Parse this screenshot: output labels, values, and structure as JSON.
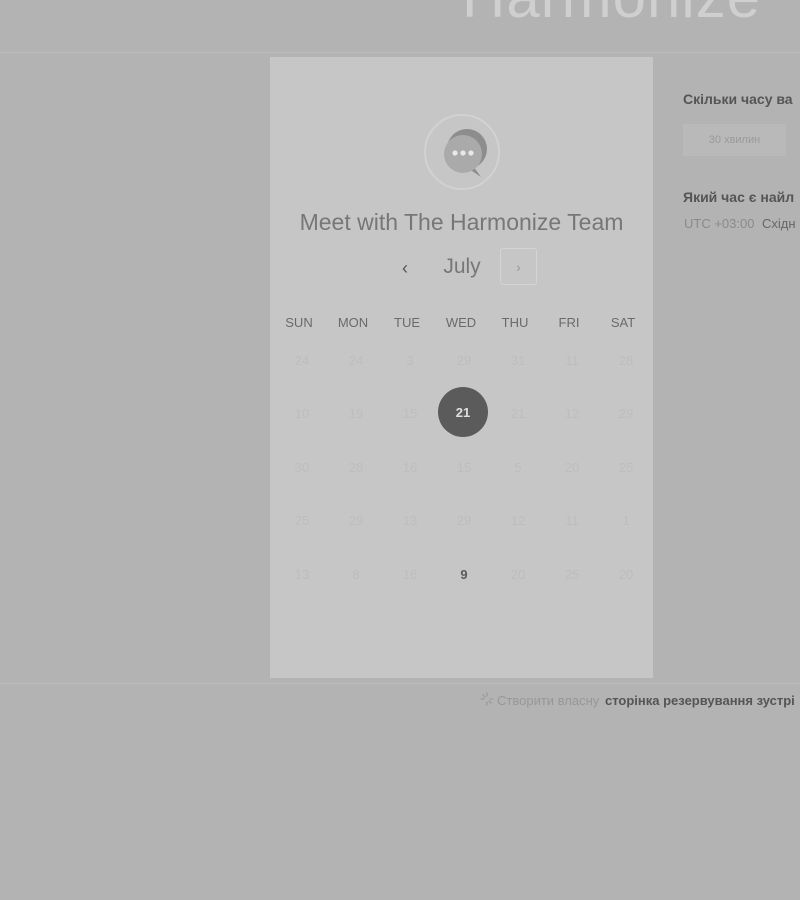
{
  "header": {
    "brand_name": "Harmonize",
    "logo_icon": "brand-logo-icon"
  },
  "card": {
    "avatar_icon": "chat-bubble-icon",
    "title": "Meet with The Harmonize Team",
    "calendar": {
      "month": "July",
      "prev_icon": "‹",
      "next_icon": "›",
      "weekdays": [
        "SUN",
        "MON",
        "TUE",
        "WED",
        "THU",
        "FRI",
        "SAT"
      ],
      "weeks": [
        [
          "24",
          "24",
          "3",
          "29",
          "31",
          "11",
          "28"
        ],
        [
          "10",
          "19",
          "15",
          "21",
          "21",
          "12",
          "29"
        ],
        [
          "30",
          "28",
          "16",
          "15",
          "5",
          "20",
          "25"
        ],
        [
          "25",
          "29",
          "13",
          "29",
          "12",
          "11",
          "1"
        ],
        [
          "13",
          "8",
          "16",
          "9",
          "20",
          "25",
          "20"
        ]
      ],
      "selected_day": "21",
      "available_day": "9"
    }
  },
  "side_panel": {
    "duration_question": "Скільки часу ва",
    "duration_option": "30 хвилин",
    "time_question": "Який час є найл",
    "timezone_offset": "UTC +03:00",
    "timezone_name": "Східн"
  },
  "footer": {
    "icon": "sparkle-icon",
    "prefix": "Створити власну",
    "link": "сторінка резервування зустрі"
  },
  "colors": {
    "overlay_background": "#b3b3b3",
    "card_background": "#c6c6c6",
    "selected_day": "#5b5b5b"
  }
}
